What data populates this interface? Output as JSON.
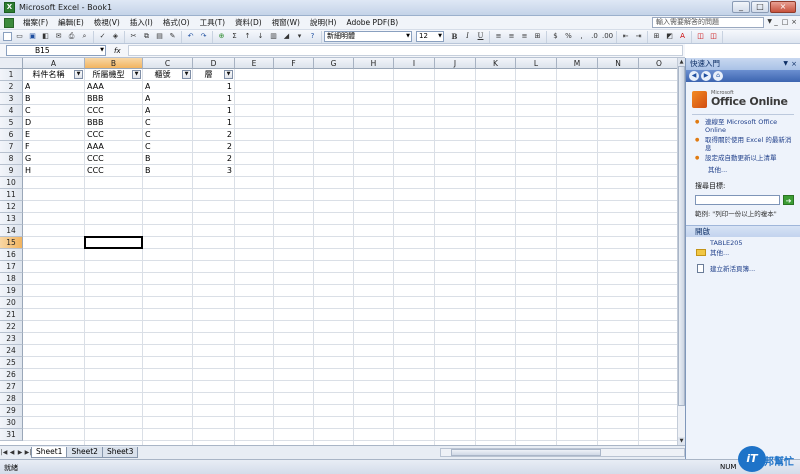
{
  "window": {
    "title": "Microsoft Excel - Book1",
    "min": "_",
    "max": "□",
    "close": "×"
  },
  "menu": {
    "items": [
      "檔案(F)",
      "編輯(E)",
      "檢視(V)",
      "插入(I)",
      "格式(O)",
      "工具(T)",
      "資料(D)",
      "視窗(W)",
      "說明(H)",
      "Adobe PDF(B)"
    ],
    "help_placeholder": "輸入需要解答的問題",
    "help_arrow": "▼",
    "doc_controls": [
      "_",
      "□",
      "×"
    ]
  },
  "toolbar": {
    "font_name": "新細明體",
    "font_size": "12",
    "combo_arrow": "▼",
    "bold": "B",
    "italic": "I",
    "underline": "U",
    "sum": "Σ",
    "currency": "$",
    "percent": "%",
    "comma": ",",
    "inc_decimal": ".0",
    "dec_decimal": ".00",
    "font_color": "A"
  },
  "formula_bar": {
    "name_box": "B15",
    "name_arrow": "▼",
    "fx": "fx",
    "content": ""
  },
  "grid": {
    "columns": [
      "A",
      "B",
      "C",
      "D",
      "E",
      "F",
      "G",
      "H",
      "I",
      "J",
      "K",
      "L",
      "M",
      "N",
      "O"
    ],
    "selected_column": "B",
    "selected_row": 15,
    "row_count": 31,
    "filter_arrow": "▼",
    "header_row": [
      "料件名稱",
      "所屬機型",
      "櫃號",
      "層"
    ],
    "data_rows": [
      [
        "A",
        "AAA",
        "A",
        "1"
      ],
      [
        "B",
        "BBB",
        "A",
        "1"
      ],
      [
        "C",
        "CCC",
        "A",
        "1"
      ],
      [
        "D",
        "BBB",
        "C",
        "1"
      ],
      [
        "E",
        "CCC",
        "C",
        "2"
      ],
      [
        "F",
        "AAA",
        "C",
        "2"
      ],
      [
        "G",
        "CCC",
        "B",
        "2"
      ],
      [
        "H",
        "CCC",
        "B",
        "3"
      ]
    ]
  },
  "sheets": {
    "nav": [
      "|◀",
      "◀",
      "▶",
      "▶|"
    ],
    "tabs": [
      "Sheet1",
      "Sheet2",
      "Sheet3"
    ],
    "active": "Sheet1"
  },
  "status": {
    "left": "就緒",
    "num": "NUM"
  },
  "task_pane": {
    "title": "快速入門",
    "header_arrow": "▼",
    "close": "×",
    "nav_buttons": [
      "◀",
      "▶",
      "⌂"
    ],
    "logo_small": "Microsoft",
    "logo_text": "Office Online",
    "bullets": [
      "連線至 Microsoft Office Online",
      "取得關於使用 Excel 的最新消息",
      "設定成自動更新以上清單"
    ],
    "more_link": "其他...",
    "search_label": "搜尋目標:",
    "go_button": "➔",
    "search_example": "範例: \"列印一份以上的複本\"",
    "open_section": "開啟",
    "open_files": [
      "TABLE205",
      "其他..."
    ],
    "new_workbook": "建立新活頁簿..."
  },
  "watermark": {
    "mark": "iT",
    "text": "邦幫忙"
  }
}
